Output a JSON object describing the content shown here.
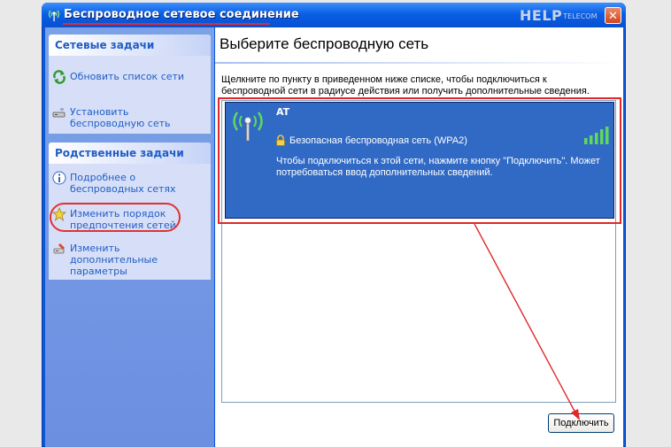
{
  "window": {
    "title": "Беспроводное сетевое соединение",
    "watermark_brand": "HELP",
    "watermark_suffix": "TELECOM",
    "close_glyph": "✕"
  },
  "sidebar": {
    "network_tasks": {
      "title": "Сетевые задачи",
      "items": [
        {
          "label": "Обновить список сети",
          "icon": "refresh-icon"
        },
        {
          "label": "Установить беспроводную сеть",
          "icon": "wireless-setup-icon"
        }
      ]
    },
    "related_tasks": {
      "title": "Родственные задачи",
      "items": [
        {
          "label": "Подробнее о беспроводных сетях",
          "icon": "info-icon"
        },
        {
          "label": "Изменить порядок предпочтения сетей",
          "icon": "star-icon"
        },
        {
          "label": "Изменить дополнительные параметры",
          "icon": "settings-icon"
        }
      ]
    }
  },
  "main": {
    "heading": "Выберите беспроводную сеть",
    "instruction": "Щелкните по пункту в приведенном ниже списке, чтобы подключиться к беспроводной сети в радиусе действия или получить дополнительные сведения.",
    "networks": [
      {
        "name": "AT",
        "security": "Безопасная беспроводная сеть (WPA2)",
        "hint": "Чтобы подключиться к этой сети, нажмите кнопку \"Подключить\". Может потребоваться ввод дополнительных сведений.",
        "signal_bars": 5,
        "signal_max": 5
      }
    ],
    "connect_label": "Подключить"
  },
  "colors": {
    "titlebar": "#0a5fe5",
    "sidebar": "#7ba2e7",
    "selection": "#316ac5",
    "annotation": "#e02828",
    "signal": "#5fd85c"
  }
}
